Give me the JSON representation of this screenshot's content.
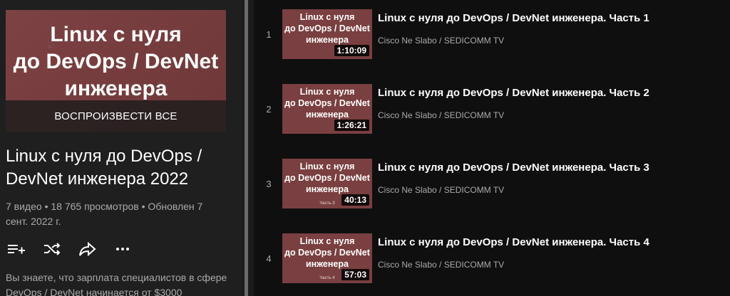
{
  "playlist": {
    "hero_title": "Linux с нуля\nдо DevOps / DevNet\nинженера",
    "play_all": "ВОСПРОИЗВЕСТИ ВСЕ",
    "title": "Linux с нуля до DevOps / DevNet инженера 2022",
    "meta": "7 видео • 18 765 просмотров • Обновлен 7 сент. 2022 г.",
    "description": "Вы знаете, что зарплата специалистов в сфере DevOps / DevNet начинается от $3000",
    "actions": [
      {
        "icon": "add-to-queue-icon"
      },
      {
        "icon": "shuffle-icon"
      },
      {
        "icon": "share-icon"
      },
      {
        "icon": "more-icon"
      }
    ]
  },
  "videos": [
    {
      "index": "1",
      "thumb_title": "Linux с нуля\nдо DevOps / DevNet\nинженера",
      "duration": "1:10:09",
      "title": "Linux с нуля до DevOps / DevNet инженера. Часть 1",
      "channel": "Cisco Ne Slabo / SEDICOMM TV"
    },
    {
      "index": "2",
      "thumb_title": "Linux с нуля\nдо DevOps / DevNet\nинженера",
      "duration": "1:26:21",
      "title": "Linux с нуля до DevOps / DevNet инженера. Часть 2",
      "channel": "Cisco Ne Slabo / SEDICOMM TV"
    },
    {
      "index": "3",
      "thumb_title": "Linux с нуля\nдо DevOps / DevNet\nинженера",
      "thumb_sub": "Часть 3",
      "duration": "40:13",
      "title": "Linux с нуля до DevOps / DevNet инженера. Часть 3",
      "channel": "Cisco Ne Slabo / SEDICOMM TV"
    },
    {
      "index": "4",
      "thumb_title": "Linux с нуля\nдо DevOps / DevNet\nинженера",
      "thumb_sub": "Часть 4",
      "duration": "57:03",
      "title": "Linux с нуля до DevOps / DevNet инженера. Часть 4",
      "channel": "Cisco Ne Slabo / SEDICOMM TV"
    }
  ]
}
